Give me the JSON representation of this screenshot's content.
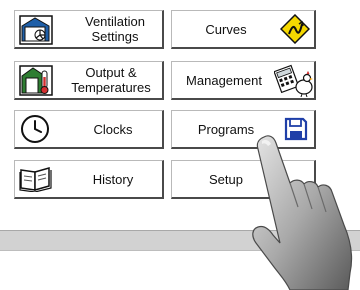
{
  "menu": {
    "ventilation": {
      "line1": "Ventilation",
      "line2": "Settings",
      "icon": "fan-house-icon"
    },
    "curves": {
      "label": "Curves",
      "icon": "warning-curve-icon"
    },
    "output": {
      "line1": "Output &",
      "line2": "Temperatures",
      "icon": "thermometer-house-icon"
    },
    "management": {
      "label": "Management",
      "icon": "calculator-chicken-icon"
    },
    "clocks": {
      "label": "Clocks",
      "icon": "clock-icon"
    },
    "programs": {
      "label": "Programs",
      "icon": "floppy-disk-icon"
    },
    "history": {
      "label": "History",
      "icon": "open-book-icon"
    },
    "setup": {
      "label": "Setup"
    }
  },
  "colors": {
    "button_border_dark": "#4a4a4a",
    "icon_blue": "#1f5fa8",
    "icon_green": "#2e7d32",
    "warning_yellow": "#f5d800",
    "thermometer_red": "#d32f2f"
  }
}
